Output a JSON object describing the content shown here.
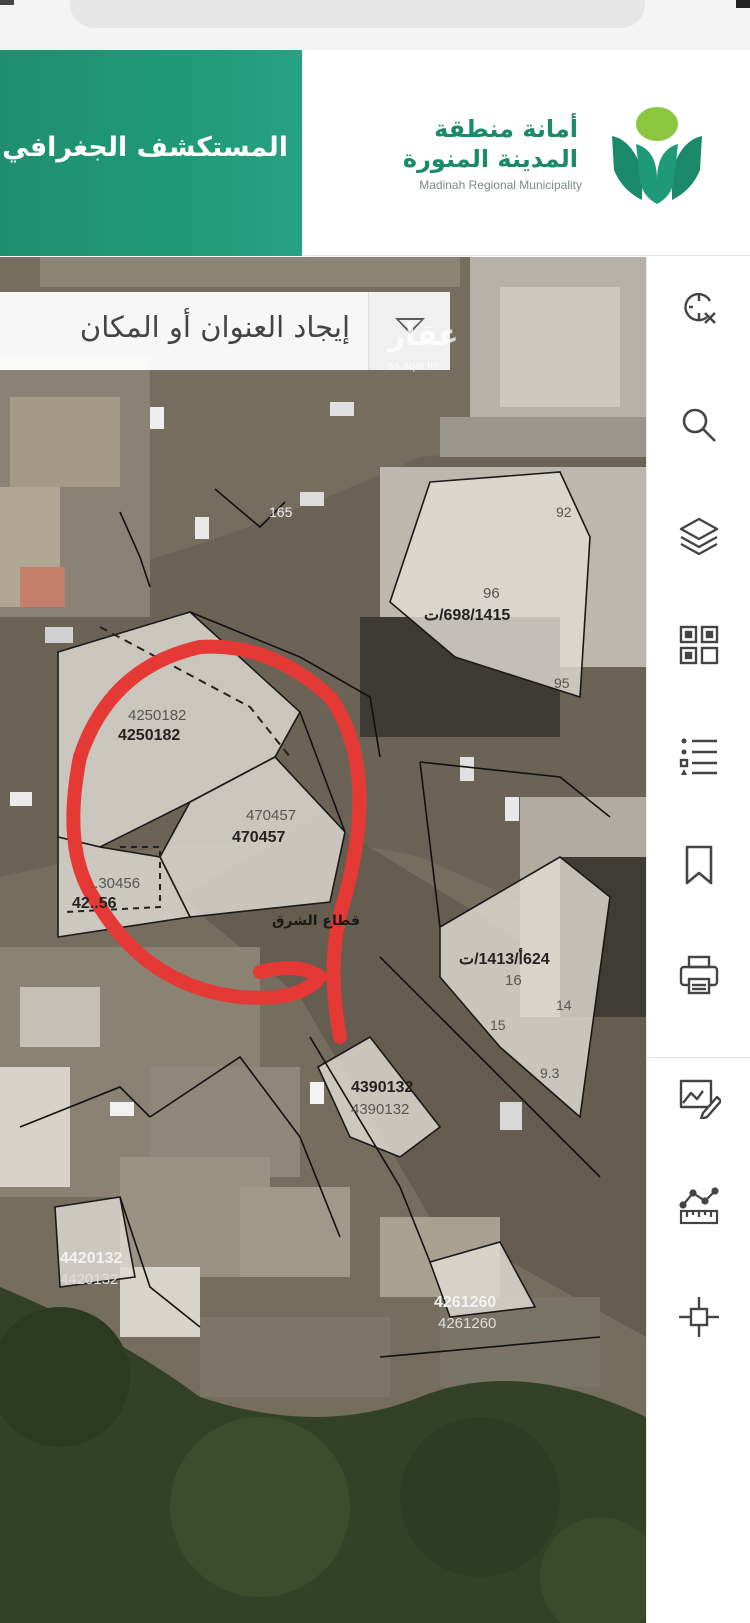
{
  "header": {
    "app_title": "المستكشف الجغرافي",
    "org_name_ar_line1": "أمانة منطقة",
    "org_name_ar_line2": "المدينة المنورة",
    "org_name_en": "Madinah Regional Municipality"
  },
  "search": {
    "placeholder": "إيجاد العنوان أو المكان"
  },
  "watermark": {
    "text": "عقار",
    "url": "sa.aqar.fm"
  },
  "map": {
    "parcels": [
      {
        "id": "p-4250182",
        "label_bold": "4250182",
        "label_light": "4250182"
      },
      {
        "id": "p-470457",
        "label_bold": "470457",
        "label_light": "470457"
      },
      {
        "id": "p-4290456",
        "label_bold": "42..56",
        "label_light": "..30456"
      },
      {
        "id": "p-698",
        "label_bold": "698/1415/ت",
        "label_light": "96"
      },
      {
        "id": "p-624",
        "label_bold": "624أ/1413/ت",
        "label_light": "16"
      },
      {
        "id": "p-4390132",
        "label_bold": "4390132",
        "label_light": "4390132"
      },
      {
        "id": "p-4420132",
        "label_bold": "4420132",
        "label_light": "4420132"
      },
      {
        "id": "p-4261260",
        "label_bold": "4261260",
        "label_light": "4261260"
      }
    ],
    "small_numbers": [
      "165",
      "92",
      "95",
      "14",
      "15",
      "9.3"
    ],
    "street_label": "قطاع الشرق",
    "highlight_color": "#e53935"
  },
  "toolbar": {
    "items": [
      {
        "name": "clear-selection-icon"
      },
      {
        "name": "search-icon"
      },
      {
        "name": "layers-icon"
      },
      {
        "name": "qr-code-icon"
      },
      {
        "name": "legend-list-icon"
      },
      {
        "name": "bookmark-icon"
      },
      {
        "name": "print-icon"
      },
      {
        "name": "draw-edit-icon"
      },
      {
        "name": "measure-icon"
      },
      {
        "name": "locate-crosshair-icon"
      }
    ]
  }
}
